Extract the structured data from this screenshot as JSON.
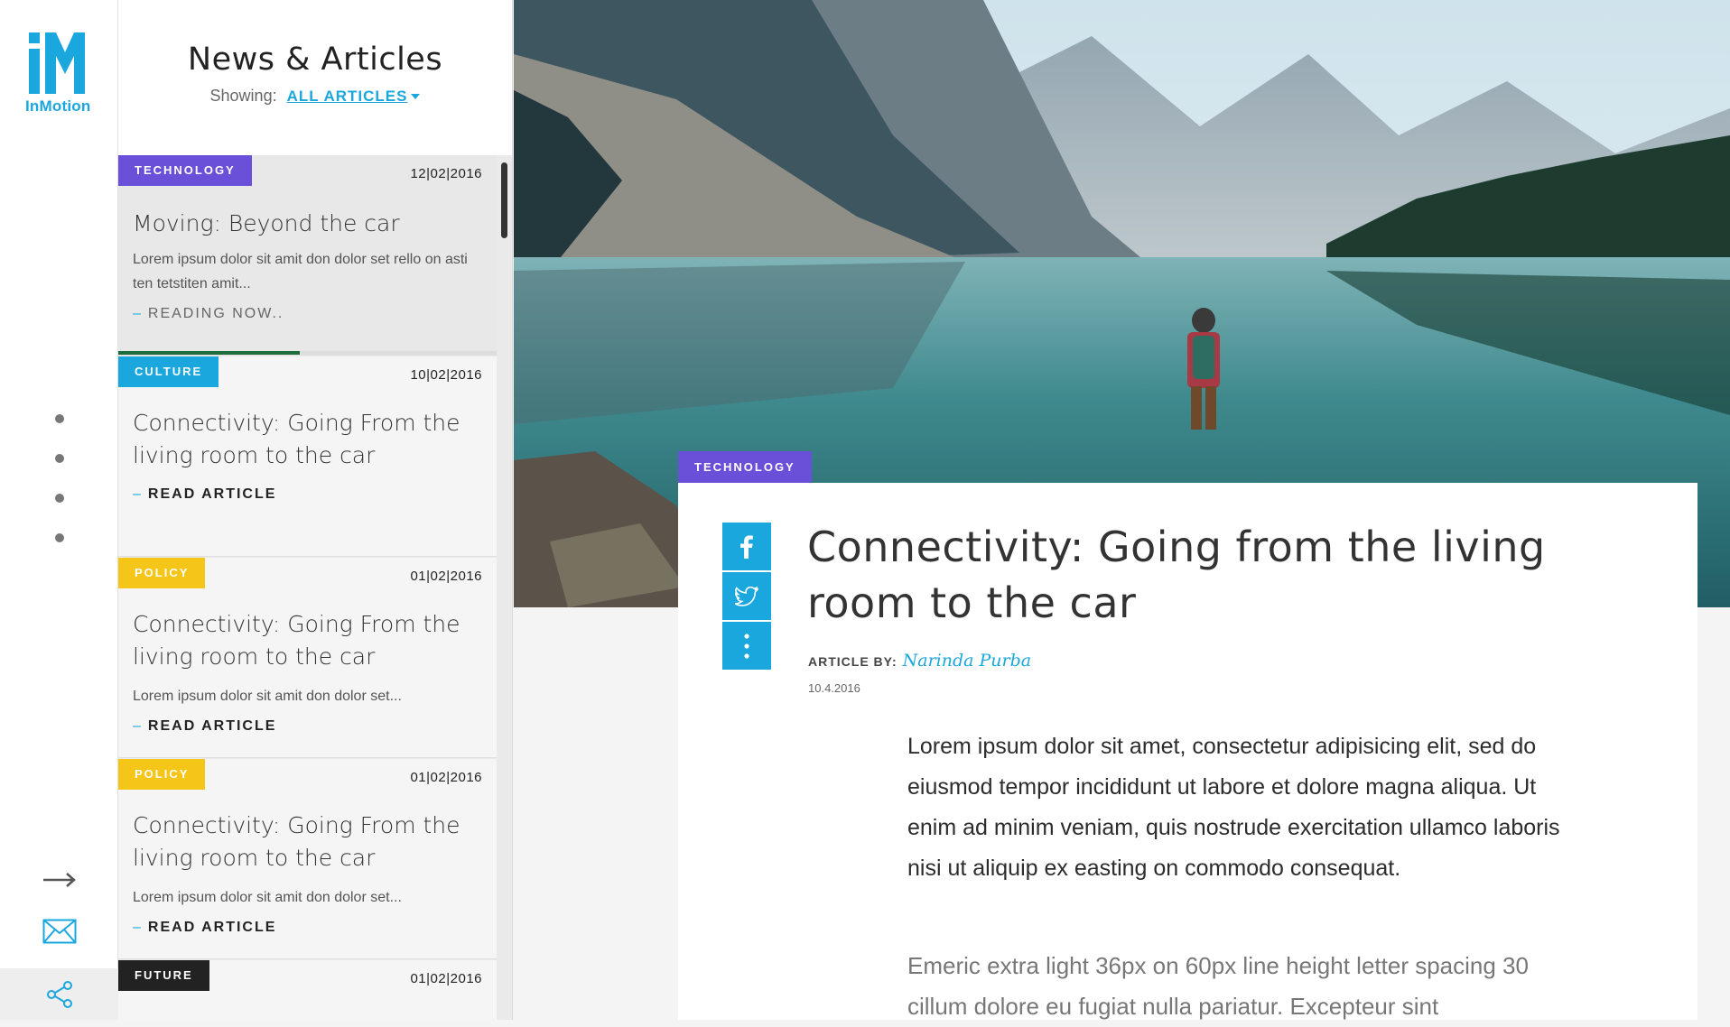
{
  "brand": {
    "name": "InMotion",
    "accent": "#1aa7dd"
  },
  "panel": {
    "title": "News & Articles",
    "showing_label": "Showing:",
    "filter_label": "ALL ARTICLES"
  },
  "articles": [
    {
      "tag": "TECHNOLOGY",
      "tag_color": "#6a4fd8",
      "date": "12|02|2016",
      "title": "Moving: Beyond the car",
      "desc": "Lorem ipsum dolor sit amit don dolor set rello on asti ten tetstiten amit...",
      "cta": "READING NOW..",
      "progress": 0.48
    },
    {
      "tag": "CULTURE",
      "tag_color": "#1aa7dd",
      "date": "10|02|2016",
      "title": "Connectivity: Going From the living room to the car",
      "cta": "READ ARTICLE"
    },
    {
      "tag": "POLICY",
      "tag_color": "#f5c518",
      "date": "01|02|2016",
      "title": "Connectivity: Going From the living room to the car",
      "desc": "Lorem ipsum dolor sit amit don dolor set...",
      "cta": "READ ARTICLE"
    },
    {
      "tag": "POLICY",
      "tag_color": "#f5c518",
      "date": "01|02|2016",
      "title": "Connectivity: Going From the living room to the car",
      "desc": "Lorem ipsum dolor sit amit don dolor set...",
      "cta": "READ ARTICLE"
    },
    {
      "tag": "FUTURE",
      "tag_color": "#222222",
      "date": "01|02|2016"
    }
  ],
  "article": {
    "tag": "TECHNOLOGY",
    "title": "Connectivity: Going from the living room to the car",
    "byline_label": "ARTICLE BY:",
    "author": "Narinda Purba",
    "date": "10.4.2016",
    "lead": "Lorem ipsum dolor sit amet, consectetur adipisicing elit, sed do eiusmod tempor incididunt ut labore et dolore magna aliqua. Ut enim ad minim veniam, quis nostrude exercitation ullamco laboris nisi ut aliquip ex easting on commodo consequat.",
    "body": "Emeric extra light 36px on 60px line height letter spacing 30 cillum dolore eu fugiat nulla pariatur. Excepteur sint"
  },
  "icons": {
    "rail": [
      "arrow-right-icon",
      "mail-icon",
      "share-icon"
    ],
    "social": [
      "facebook-icon",
      "twitter-icon",
      "more-icon"
    ]
  }
}
